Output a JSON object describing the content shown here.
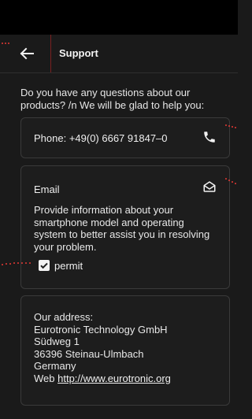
{
  "app_bar": {
    "title": "Support",
    "back_icon": "arrow-left-icon"
  },
  "intro_text": "Do you have any questions about our products? /n We will be glad to help you:",
  "phone_card": {
    "label": "Phone: +49(0) 6667 91847–0",
    "icon": "phone-icon"
  },
  "email_card": {
    "title": "Email",
    "icon": "mail-icon",
    "description": "Provide information about your smartphone model and operating system to better assist you in resolving your problem.",
    "checkbox_label": "permit",
    "checkbox_checked": true
  },
  "address_card": {
    "heading": "Our address:",
    "lines": [
      "Eurotronic Technology GmbH",
      "Südweg 1",
      "36396 Steinau-Ulmbach",
      "Germany"
    ],
    "web_prefix": "Web ",
    "web_link": "http://www.eurotronic.org"
  },
  "colors": {
    "background": "#1a1a1a",
    "statusbar": "#000000",
    "card_border": "#3a3a3a",
    "accent_divider": "#7a2020",
    "annotation_dots": "#e53935"
  }
}
